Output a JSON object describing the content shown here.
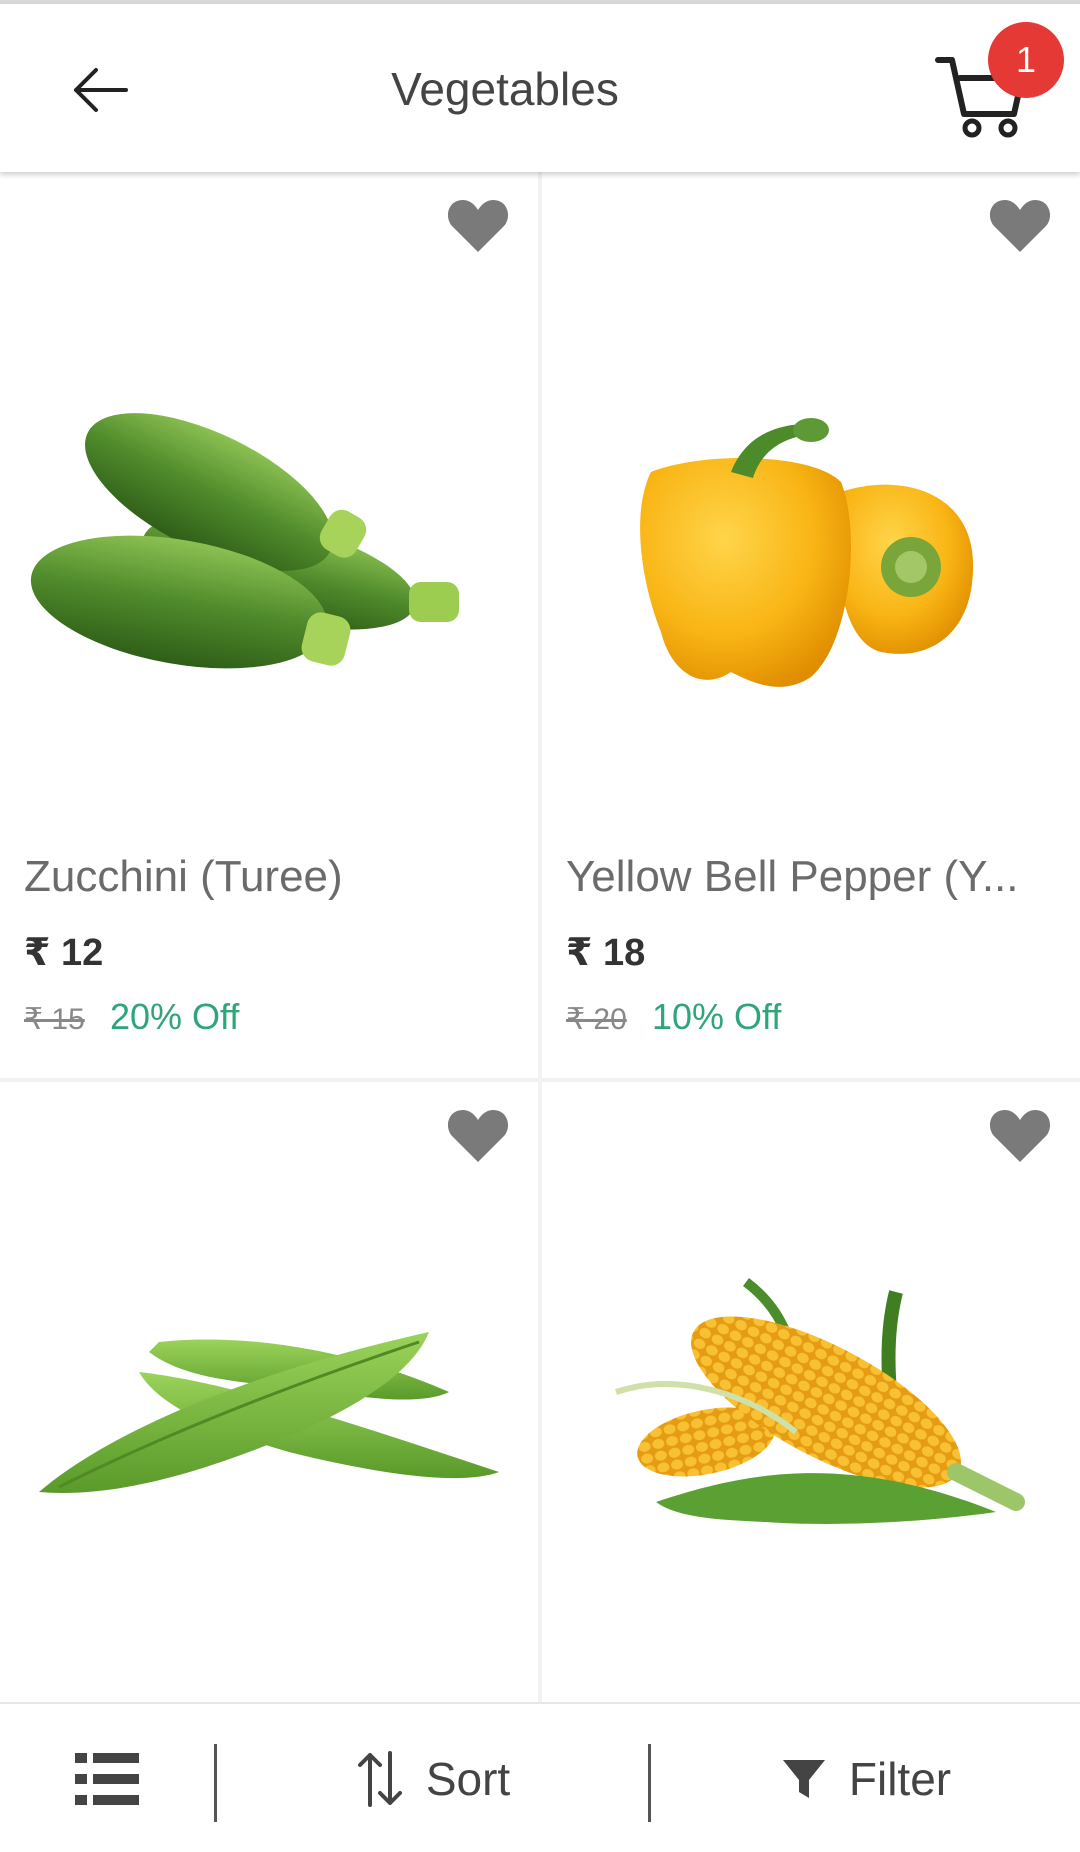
{
  "header": {
    "title": "Vegetables",
    "cart_count": "1"
  },
  "products": [
    {
      "name": "Zucchini (Turee)",
      "price": "₹ 12",
      "mrp": "₹ 15",
      "discount": "20% Off",
      "image": "zucchini-image"
    },
    {
      "name": "Yellow Bell Pepper (Y...",
      "price": "₹ 18",
      "mrp": "₹ 20",
      "discount": "10% Off",
      "image": "yellow-bell-pepper-image"
    },
    {
      "image": "ridge-gourd-image"
    },
    {
      "image": "sweet-corn-image"
    }
  ],
  "bottom_bar": {
    "sort_label": "Sort",
    "filter_label": "Filter"
  },
  "colors": {
    "badge": "#e53935",
    "discount": "#2fa57a",
    "heart": "#7a7a7a"
  },
  "icons": [
    "back-arrow-icon",
    "cart-icon",
    "heart-icon",
    "list-view-icon",
    "sort-icon",
    "filter-icon"
  ]
}
